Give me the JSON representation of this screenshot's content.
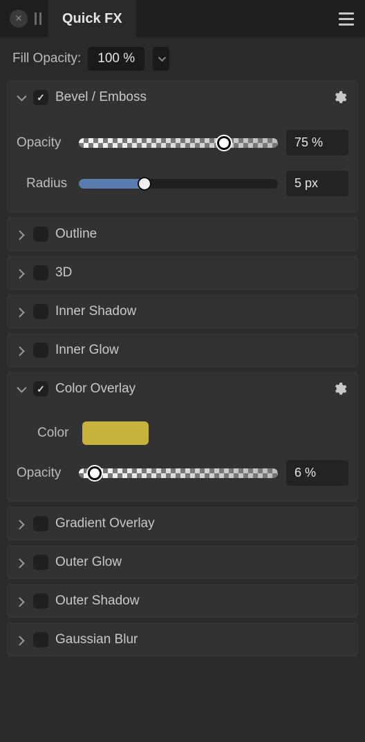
{
  "header": {
    "tab_title": "Quick FX"
  },
  "fill_opacity": {
    "label": "Fill Opacity:",
    "value": "100 %"
  },
  "effects": {
    "bevel": {
      "name": "Bevel / Emboss",
      "opacity_label": "Opacity",
      "opacity_value": "75 %",
      "opacity_pct": 73,
      "radius_label": "Radius",
      "radius_value": "5 px",
      "radius_pct": 33
    },
    "outline": {
      "name": "Outline"
    },
    "three_d": {
      "name": "3D"
    },
    "inner_shadow": {
      "name": "Inner Shadow"
    },
    "inner_glow": {
      "name": "Inner Glow"
    },
    "color_overlay": {
      "name": "Color Overlay",
      "color_label": "Color",
      "color_hex": "#c8b23f",
      "opacity_label": "Opacity",
      "opacity_value": "6 %",
      "opacity_pct": 8
    },
    "gradient_overlay": {
      "name": "Gradient Overlay"
    },
    "outer_glow": {
      "name": "Outer Glow"
    },
    "outer_shadow": {
      "name": "Outer Shadow"
    },
    "gaussian_blur": {
      "name": "Gaussian Blur"
    }
  }
}
